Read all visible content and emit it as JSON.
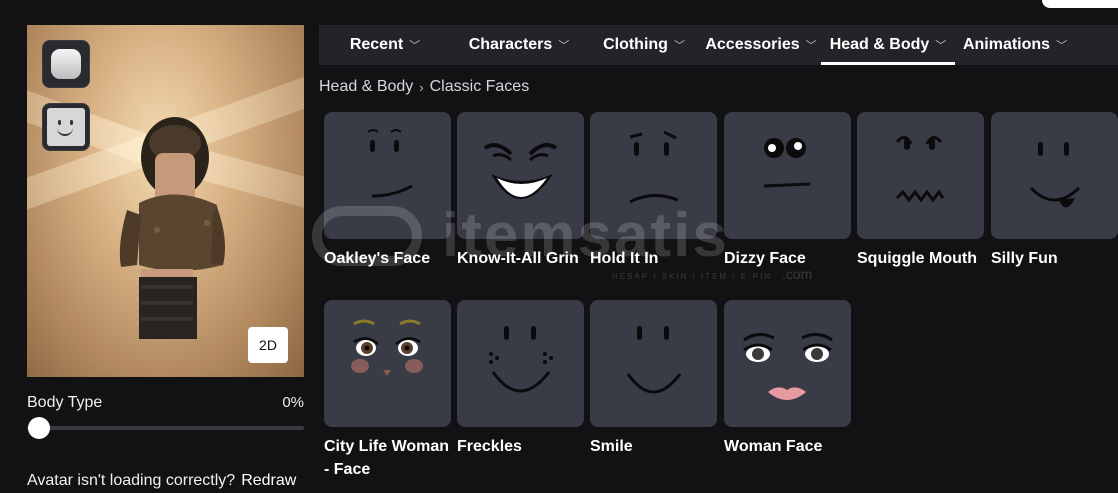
{
  "nav": {
    "tabs": [
      {
        "label": "Recent",
        "active": false
      },
      {
        "label": "Characters",
        "active": false
      },
      {
        "label": "Clothing",
        "active": false
      },
      {
        "label": "Accessories",
        "active": false
      },
      {
        "label": "Head & Body",
        "active": true
      },
      {
        "label": "Animations",
        "active": false
      }
    ]
  },
  "breadcrumb": {
    "parent": "Head & Body",
    "current": "Classic Faces"
  },
  "avatar": {
    "toggle_label": "2D",
    "body_type_label": "Body Type",
    "body_type_value": "0%",
    "body_type_level": 0,
    "loading_prompt": "Avatar isn't loading correctly?",
    "redraw_label": "Redraw"
  },
  "items": [
    {
      "name": "Oakley's Face"
    },
    {
      "name": "Know-It-All Grin"
    },
    {
      "name": "Hold It In"
    },
    {
      "name": "Dizzy Face"
    },
    {
      "name": "Squiggle Mouth"
    },
    {
      "name": "Silly Fun"
    },
    {
      "name": "City Life Woman - Face"
    },
    {
      "name": "Freckles"
    },
    {
      "name": "Smile"
    },
    {
      "name": "Woman Face"
    }
  ],
  "watermark": {
    "brand": "itemsatis",
    "tagline": "HESAP / SKIN / ITEM / E-PIN",
    "domain": ".com"
  },
  "colors": {
    "background": "#121215",
    "tile": "#393b47",
    "nav": "#232429",
    "active_underline": "#ffffff"
  }
}
